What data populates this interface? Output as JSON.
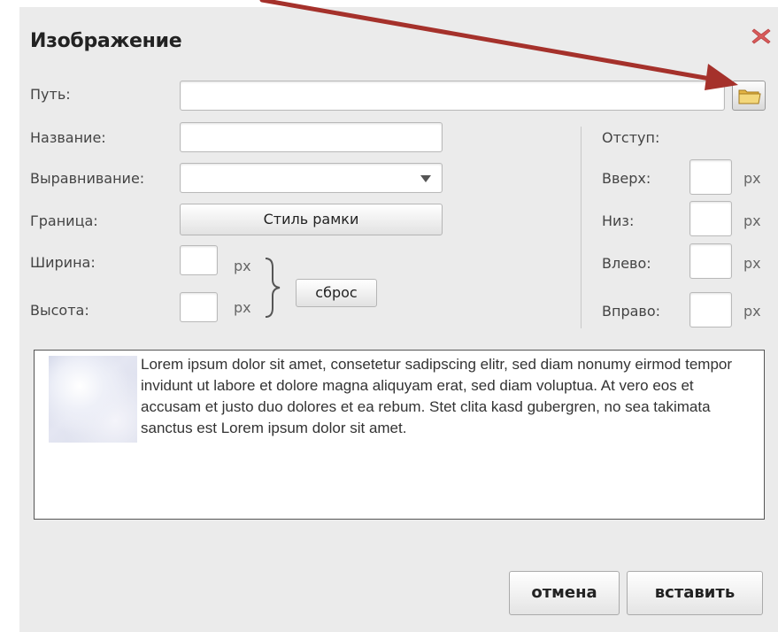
{
  "dialog": {
    "title": "Изображение",
    "path_label": "Путь:",
    "name_label": "Название:",
    "align_label": "Выравнивание:",
    "border_label": "Граница:",
    "border_button": "Стиль рамки",
    "width_label": "Ширина:",
    "height_label": "Высота:",
    "unit": "px",
    "reset_button": "сброс",
    "padding": {
      "title": "Отступ:",
      "top_label": "Вверх:",
      "bottom_label": "Низ:",
      "left_label": "Влево:",
      "right_label": "Вправо:"
    },
    "preview_text": "Lorem ipsum dolor sit amet, consetetur sadipscing elitr, sed diam nonumy eirmod tempor invidunt ut labore et dolore magna aliquyam erat, sed diam voluptua. At vero eos et accusam et justo duo dolores et ea rebum. Stet clita kasd gubergren, no sea takimata sanctus est Lorem ipsum dolor sit amet.",
    "cancel_button": "отмена",
    "insert_button": "вставить"
  },
  "icons": {
    "close": "close-icon",
    "folder": "folder-icon",
    "dropdown": "chevron-down-icon",
    "brace": "brace-icon",
    "arrow": "arrow-annotation"
  },
  "colors": {
    "arrow": "#a5312b",
    "close": "#d85a5a",
    "folder": "#e8c35c"
  }
}
